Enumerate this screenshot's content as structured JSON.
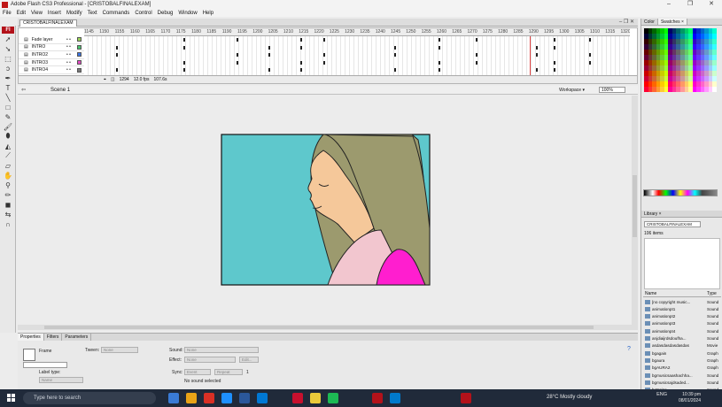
{
  "window": {
    "title": "Adobe Flash CS3 Professional - [CRISTOBALFINALEXAM]",
    "controls": [
      "–",
      "❐",
      "✕"
    ]
  },
  "menu": [
    "File",
    "Edit",
    "View",
    "Insert",
    "Modify",
    "Text",
    "Commands",
    "Control",
    "Debug",
    "Window",
    "Help"
  ],
  "document_tab": "CRISTOBALFINALEXAM",
  "timeline": {
    "frame_numbers": [
      "1145",
      "1150",
      "1155",
      "1160",
      "1165",
      "1170",
      "1175",
      "1180",
      "1185",
      "1190",
      "1195",
      "1200",
      "1205",
      "1210",
      "1215",
      "1220",
      "1225",
      "1230",
      "1235",
      "1240",
      "1245",
      "1250",
      "1255",
      "1260",
      "1265",
      "1270",
      "1275",
      "1280",
      "1285",
      "1290",
      "1295",
      "1300",
      "1305",
      "1310",
      "1315",
      "1320"
    ],
    "layers": [
      {
        "name": "Fade layer",
        "color": "#9bd25a"
      },
      {
        "name": "INTRO",
        "color": "#4ac26e"
      },
      {
        "name": "INTRO2",
        "color": "#3a73e0"
      },
      {
        "name": "INTRO3",
        "color": "#e04ac2"
      },
      {
        "name": "INTRO4",
        "color": "#777777"
      }
    ],
    "footer": {
      "current_frame": "1294",
      "fps": "12.0 fps",
      "elapsed": "107.6s"
    }
  },
  "editbar": {
    "scene": "Scene 1",
    "workspace": "Workspace ▾",
    "zoom": "100%"
  },
  "properties": {
    "tabs": [
      "Properties",
      "Filters",
      "Parameters"
    ],
    "frame_label": "Frame",
    "tween_label": "Tween:",
    "tween_value": "None",
    "sound_label": "Sound:",
    "sound_value": "None",
    "effect_label": "Effect:",
    "effect_value": "None",
    "edit_button": "Edit...",
    "sync_label": "Sync:",
    "sync_value": "Event",
    "repeat_value": "Repeat",
    "repeat_count": "1",
    "label_type_label": "Label type:",
    "label_type_value": "Name",
    "no_sound": "No sound selected"
  },
  "color_panel": {
    "tabs": [
      "Color",
      "Swatches ×"
    ]
  },
  "library": {
    "tab": "Library ×",
    "document": "CRISTOBALFINALEXAM",
    "count": "106 items",
    "col_name": "Name",
    "col_type": "Type",
    "items": [
      {
        "name": "[no copyright music...",
        "type": "Sound"
      },
      {
        "name": "animationpt1",
        "type": "Sound"
      },
      {
        "name": "animationpt2",
        "type": "Sound"
      },
      {
        "name": "animationpt3",
        "type": "Sound"
      },
      {
        "name": "animationpt4",
        "type": "Sound"
      },
      {
        "name": "anjdiaijrdsdoufha...",
        "type": "Sound"
      },
      {
        "name": "asdasdasdasdasdas",
        "type": "Movie"
      },
      {
        "name": "bgagain",
        "type": "Graph"
      },
      {
        "name": "bgaura",
        "type": "Graph"
      },
      {
        "name": "bgAURA2",
        "type": "Graph"
      },
      {
        "name": "bgmusicsaashachha...",
        "type": "Sound"
      },
      {
        "name": "bgmusicsajdsaded...",
        "type": "Sound"
      },
      {
        "name": "bgNoise",
        "type": "Sound"
      }
    ]
  },
  "taskbar": {
    "search_placeholder": "Type here to search",
    "weather": "28°C  Mostly cloudy",
    "lang": "ENG",
    "time": "10:39 pm",
    "date": "08/01/2024"
  },
  "colors": {
    "stage_bg": "#5ec8cc",
    "hair": "#9c9a6e",
    "skin": "#f5c89a",
    "scarf": "#f2c6cf",
    "shirt": "#ff1ecf"
  }
}
